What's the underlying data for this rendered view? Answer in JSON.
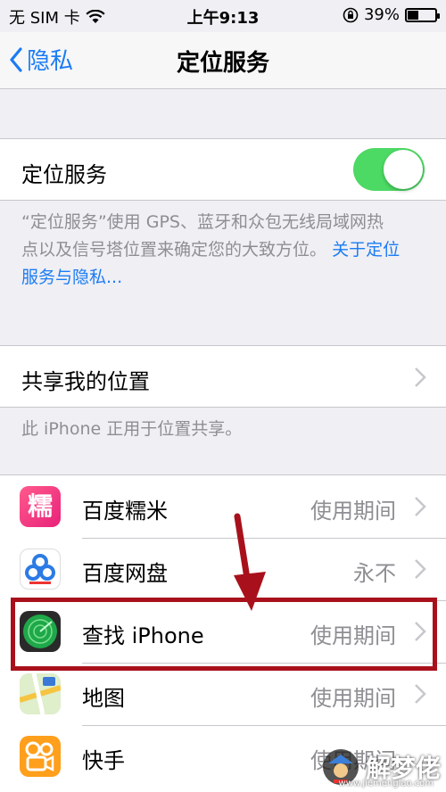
{
  "status_bar": {
    "carrier": "无 SIM 卡",
    "time": "上午9:13",
    "battery": "39%",
    "battery_level": 0.39
  },
  "nav": {
    "back_label": "隐私",
    "title": "定位服务"
  },
  "location_services": {
    "label": "定位服务",
    "enabled": true,
    "toggle_color": "#4cd964",
    "description_line1": "“定位服务”使用 GPS、蓝牙和众包无线局域网热",
    "description_line2": "点以及信号塔位置来确定您的大致方位。",
    "about_link_line1": "关于定位",
    "about_link_line2": "服务与隐私..."
  },
  "share_location": {
    "label": "共享我的位置",
    "footnote": "此 iPhone 正用于位置共享。"
  },
  "apps": [
    {
      "name": "百度糯米",
      "value": "使用期间",
      "icon": "baidu-nuomi-icon",
      "icon_text": "糯"
    },
    {
      "name": "百度网盘",
      "value": "永不",
      "icon": "baidu-netdisk-icon"
    },
    {
      "name": "查找 iPhone",
      "value": "使用期间",
      "icon": "find-iphone-icon"
    },
    {
      "name": "地图",
      "value": "使用期间",
      "icon": "maps-icon"
    },
    {
      "name": "快手",
      "value": "使用期间",
      "icon": "kuaishou-icon"
    }
  ],
  "watermark": {
    "text": "解梦佬",
    "url": "www.jiemenglao.com"
  },
  "colors": {
    "accent": "#1b7cf3",
    "highlight": "#a8111b",
    "arrow": "#a8111b"
  }
}
